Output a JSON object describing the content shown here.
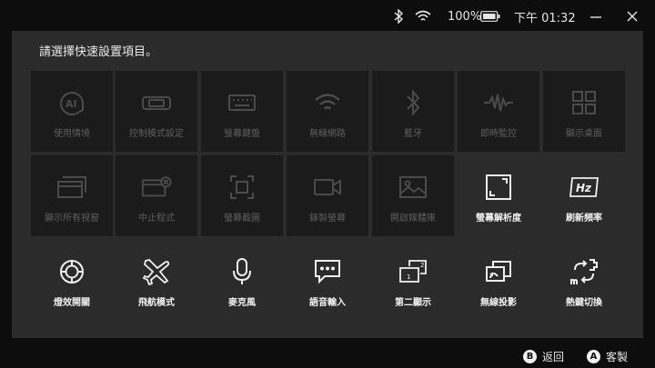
{
  "status": {
    "bluetooth_icon": "bluetooth-icon",
    "wifi_icon": "wifi-icon",
    "battery_percent": "100%",
    "time": "下午 01:32"
  },
  "window": {
    "minimize": "minimize-icon",
    "close": "close-icon"
  },
  "panel": {
    "title": "請選擇快速設置項目。"
  },
  "tiles": [
    {
      "label": "使用情境",
      "icon": "ai-scenario-icon",
      "enabled": false
    },
    {
      "label": "控制模式設定",
      "icon": "controller-icon",
      "enabled": false
    },
    {
      "label": "螢幕鍵盤",
      "icon": "keyboard-icon",
      "enabled": false
    },
    {
      "label": "無線網路",
      "icon": "wifi-icon",
      "enabled": false
    },
    {
      "label": "藍牙",
      "icon": "bluetooth-icon",
      "enabled": false
    },
    {
      "label": "即時監控",
      "icon": "waveform-icon",
      "enabled": false
    },
    {
      "label": "顯示桌面",
      "icon": "grid-icon",
      "enabled": false
    },
    {
      "label": "顯示所有視窗",
      "icon": "windows-icon",
      "enabled": false
    },
    {
      "label": "中止程式",
      "icon": "close-window-icon",
      "enabled": false
    },
    {
      "label": "螢幕截圖",
      "icon": "screenshot-icon",
      "enabled": false
    },
    {
      "label": "錄製螢幕",
      "icon": "video-camera-icon",
      "enabled": false
    },
    {
      "label": "開啟媒體庫",
      "icon": "image-icon",
      "enabled": false
    },
    {
      "label": "螢幕解析度",
      "icon": "resolution-icon",
      "enabled": true
    },
    {
      "label": "刷新頻率",
      "icon": "hz-icon",
      "enabled": true
    },
    {
      "label": "燈效開關",
      "icon": "light-ring-icon",
      "enabled": true
    },
    {
      "label": "飛航模式",
      "icon": "airplane-icon",
      "enabled": true
    },
    {
      "label": "麥克風",
      "icon": "microphone-icon",
      "enabled": true
    },
    {
      "label": "語音輸入",
      "icon": "chat-icon",
      "enabled": true
    },
    {
      "label": "第二顯示",
      "icon": "second-display-icon",
      "enabled": true
    },
    {
      "label": "無線投影",
      "icon": "cast-icon",
      "enabled": true
    },
    {
      "label": "熱鍵切換",
      "icon": "hotkey-switch-icon",
      "enabled": true
    }
  ],
  "bottom": {
    "b_key": "B",
    "b_label": "返回",
    "a_key": "A",
    "a_label": "客製"
  }
}
